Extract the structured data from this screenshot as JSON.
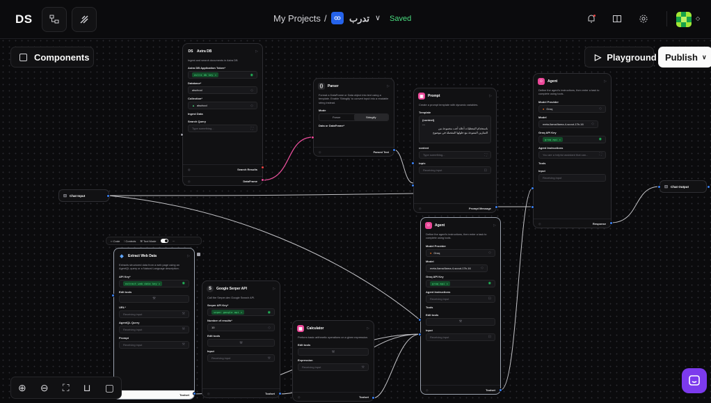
{
  "topbar": {
    "logo": "DS",
    "breadcrumb_root": "My Projects",
    "separator": "/",
    "project_name": "تدرب",
    "dropdown_glyph": "∨",
    "status": "Saved",
    "icons": [
      "workflow-icon",
      "wand-icon",
      "bell-icon",
      "book-icon",
      "gear-icon",
      "avatar"
    ]
  },
  "buttons": {
    "components": "Components",
    "playground": "Playground",
    "publish": "Publish"
  },
  "nodes": {
    "astra": {
      "logo": "DS",
      "title": "Astra DB",
      "desc": "Ingest and search documents in Astra DB",
      "token_label": "Astra DB Application Token*",
      "token_value": "astra db key ×",
      "database_label": "Database*",
      "database_value": "alschool",
      "collection_label": "Collection*",
      "collection_value": "alschool",
      "ingest_label": "Ingest Data",
      "search_label": "Search Query",
      "search_placeholder": "Type something...",
      "out1": "Search Results",
      "out2": "DataFrame"
    },
    "parser": {
      "title": "Parser",
      "desc": "Format a DataFrame or Data object into text using a template. Enable 'Stringify' to convert input into a readable string instead.",
      "mode_label": "Mode",
      "mode_options": [
        "Parser",
        "Stringify"
      ],
      "input_label": "Data or DataFrame*",
      "out": "Parsed Text"
    },
    "prompt": {
      "title": "Prompt",
      "desc": "Create a prompt template with dynamic variables.",
      "template_label": "Template",
      "template_line1": "{context}",
      "template_line2": "---",
      "template_line3": "باستخدام المعطيات أعلاه أجب مجموعة من",
      "template_line4": "التمارين المتنوعة مع حلولها المفصلة في موضوع",
      "context_label": "context",
      "context_placeholder": "Type something...",
      "topic_label": "topic",
      "topic_placeholder": "Receiving input",
      "out": "Prompt Message"
    },
    "agent1": {
      "title": "Agent",
      "desc": "Define the agent's instructions, then enter a task to complete using tools.",
      "provider_label": "Model Provider",
      "provider_value": "Groq",
      "model_label": "Model",
      "model_value": "meta-llama/llama-4-scout-17b-16",
      "key_label": "Groq API Key",
      "key_value": "groq api ×",
      "instr_label": "Agent Instructions",
      "instr_value": "You are a helpful assistant that can...",
      "tools_label": "Tools",
      "input_label": "Input",
      "input_placeholder": "Receiving input",
      "out": "Response"
    },
    "agent2": {
      "title": "Agent",
      "desc": "Define the agent's instructions, then enter a task to complete using tools.",
      "provider_label": "Model Provider",
      "provider_value": "Groq",
      "model_label": "Model",
      "model_value": "meta-llama/llama-4-scout-17b-16",
      "key_label": "Groq API Key",
      "key_value": "groq api ×",
      "instr_label": "Agent Instructions",
      "instr_value": "Receiving input",
      "tools_label": "Tools",
      "edit_tools": "Edit tools",
      "input_label": "Input",
      "input_placeholder": "Receiving input",
      "out": "Toolset"
    },
    "chat_input": {
      "title": "Chat Input"
    },
    "chat_output": {
      "title": "Chat Output"
    },
    "extract": {
      "toolbar_code": "Code",
      "toolbar_controls": "Controls",
      "toolbar_toolmode": "Tool Mode",
      "title": "Extract Web Data",
      "desc": "Extracts structured data from a web page using an AgentQL query or a Natural Language description.",
      "key_label": "API Key*",
      "key_value": "extract web data key ×",
      "edit_tools": "Edit tools",
      "url_label": "URL*",
      "url_placeholder": "Receiving input",
      "query_label": "AgentQL Query",
      "query_placeholder": "Receiving input",
      "prompt_label": "Prompt",
      "prompt_placeholder": "Receiving input",
      "out": "Toolset"
    },
    "serper": {
      "title": "Google Serper API",
      "desc": "Call the Serper.dev Google Search API.",
      "key_label": "Serper API Key*",
      "key_value": "seper google api ×",
      "num_label": "Number of results*",
      "num_value": "10",
      "edit_tools": "Edit tools",
      "input_label": "Input",
      "input_placeholder": "Receiving input",
      "out": "Toolset"
    },
    "calc": {
      "title": "Calculator",
      "desc": "Perform basic arithmetic operations on a given expression.",
      "edit_tools": "Edit tools",
      "expr_label": "Expression",
      "expr_placeholder": "Receiving input",
      "out": "Toolset"
    }
  },
  "colors": {
    "accent_pink": "#ec4899",
    "handle_blue": "#3b82f6",
    "handle_red": "#ef4444",
    "saved_green": "#4ade80",
    "launcher_purple": "#7c3aed"
  }
}
